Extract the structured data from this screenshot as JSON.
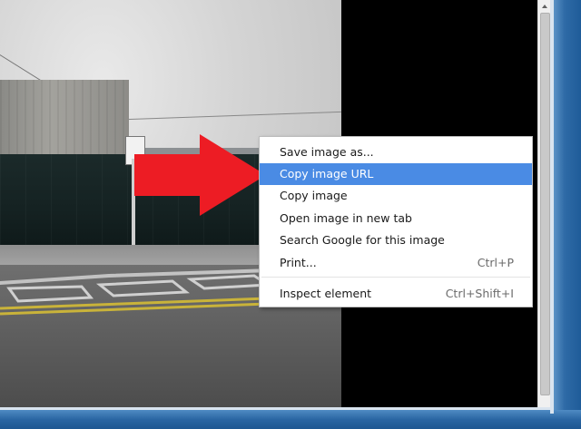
{
  "context_menu": {
    "items": [
      {
        "label": "Save image as...",
        "shortcut": ""
      },
      {
        "label": "Copy image URL",
        "shortcut": "",
        "highlighted": true
      },
      {
        "label": "Copy image",
        "shortcut": ""
      },
      {
        "label": "Open image in new tab",
        "shortcut": ""
      },
      {
        "label": "Search Google for this image",
        "shortcut": ""
      },
      {
        "label": "Print...",
        "shortcut": "Ctrl+P"
      }
    ],
    "footer_items": [
      {
        "label": "Inspect element",
        "shortcut": "Ctrl+Shift+I"
      }
    ],
    "highlight_color": "#4a8be4"
  },
  "annotation": {
    "arrow_color": "#ed1c24",
    "arrow_icon": "right-arrow-icon"
  },
  "window": {
    "frame_color": "#2e6aa6",
    "background": "#000000"
  }
}
